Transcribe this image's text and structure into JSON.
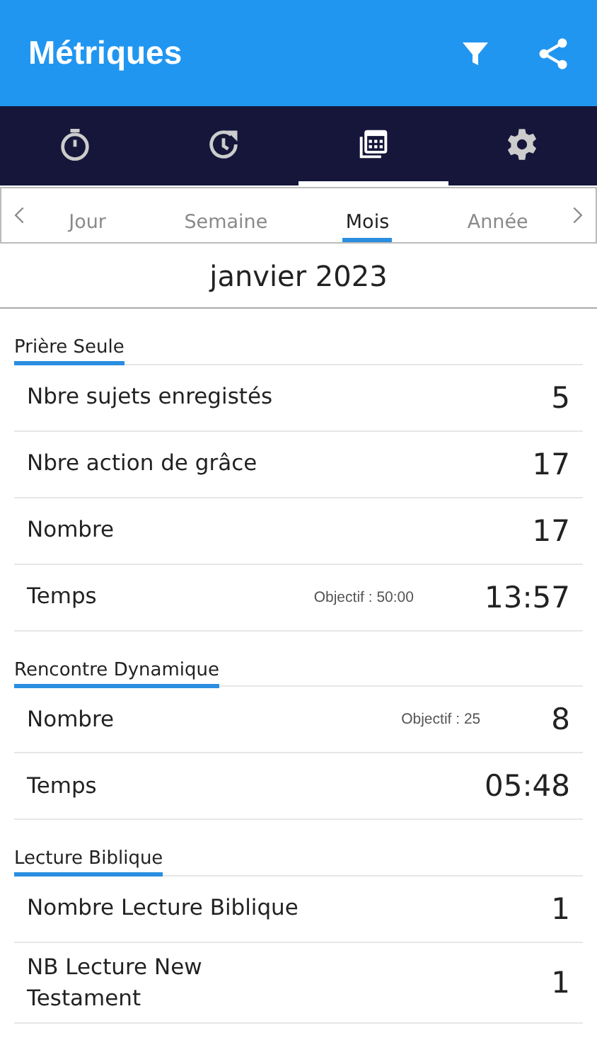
{
  "app_bar": {
    "title": "Métriques"
  },
  "nav_tabs": [
    {
      "kind": "stopwatch",
      "selected": false
    },
    {
      "kind": "history",
      "selected": false
    },
    {
      "kind": "calendar",
      "selected": true
    },
    {
      "kind": "settings",
      "selected": false
    }
  ],
  "period_tabs": [
    {
      "label": "Jour",
      "selected": false
    },
    {
      "label": "Semaine",
      "selected": false
    },
    {
      "label": "Mois",
      "selected": true
    },
    {
      "label": "Année",
      "selected": false
    }
  ],
  "period_title": "janvier 2023",
  "sections": [
    {
      "title": "Prière Seule",
      "rows": [
        {
          "label": "Nbre sujets enregistés",
          "value": "5"
        },
        {
          "label": "Nbre action de grâce",
          "value": "17"
        },
        {
          "label": "Nombre",
          "value": "17"
        },
        {
          "label": "Temps",
          "goal": "Objectif : 50:00",
          "value": "13:57"
        }
      ]
    },
    {
      "title": "Rencontre Dynamique",
      "rows": [
        {
          "label": "Nombre",
          "goal": "Objectif : 25",
          "value": "8"
        },
        {
          "label": "Temps",
          "value": "05:48"
        }
      ]
    },
    {
      "title": "Lecture Biblique",
      "rows": [
        {
          "label": "Nombre Lecture Biblique",
          "value": "1"
        },
        {
          "label": "NB Lecture New\nTestament",
          "value": "1"
        }
      ]
    }
  ]
}
